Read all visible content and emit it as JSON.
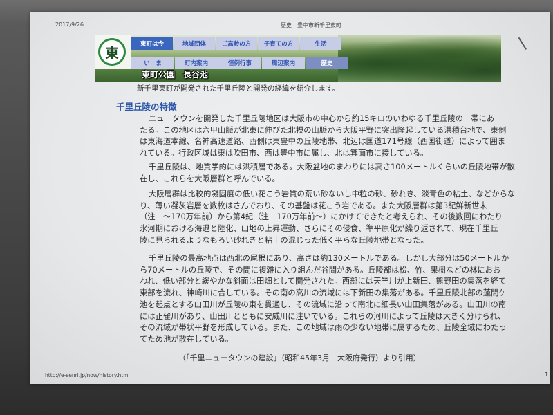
{
  "print_header": {
    "date": "2017/9/26",
    "title": "歴史　豊中市新千里東町"
  },
  "banner": {
    "logo_char": "東",
    "nav_primary": [
      {
        "label": "東町は今",
        "active": true
      },
      {
        "label": "地域団体",
        "active": false
      },
      {
        "label": "ご高齢の方",
        "active": false
      },
      {
        "label": "子育ての方",
        "active": false
      },
      {
        "label": "生活",
        "active": false
      }
    ],
    "nav_secondary": [
      {
        "label": "い　ま",
        "active": false
      },
      {
        "label": "町内案内",
        "active": false
      },
      {
        "label": "恒例行事",
        "active": false
      },
      {
        "label": "周辺案内",
        "active": false
      },
      {
        "label": "歴史",
        "active": true
      }
    ],
    "caption": "東町公園　長谷池"
  },
  "intro": "新千里東町が開発された千里丘陵と開発の経緯を紹介します。",
  "section": {
    "heading": "千里丘陵の特徴",
    "paragraphs": [
      {
        "lines": [
          "ニュータウンを開発した千里丘陵地区は大阪市の中心から約15キロのいわゆる千里丘陵の一帯にあ",
          "たる。この地区は六甲山脈が北東に伸びた北摂の山脈から大阪平野に突出隆起している洪積台地で、東側",
          "は東海道本線、名神高速道路、西側は東豊中の丘陵地帯、北辺は国道171号線（西国街道）によって囲ま",
          "れている。行政区域は東は吹田市、西は豊中市に属し、北は箕面市に接している。"
        ]
      },
      {
        "lines": [
          "千里丘陵は、地質学的には洪積層である。大阪盆地のまわりには高さ100メートルくらいの丘陵地帯が散",
          "在し、これらを大阪層群と呼んでいる。"
        ]
      },
      {
        "lines": [
          "大阪層群は比較的凝固度の低い花こう岩質の荒い砂ないし中粒の砂、砂れき、淡青色の粘土、などからな",
          "り、薄い凝灰岩層を数枚はさんでおり、その基盤は花こう岩である。また大阪層群は第3紀鮮新世末",
          "（注　～170万年前）から第4紀（注　170万年前～）にかけてできたと考えられ、その後数回にわたり",
          "氷河期における海退と陸化、山地の上昇運動、さらにその侵食、準平原化が繰り返されて、現在千里丘",
          "陵に見られるようなもろい砂れきと粘土の混じった低く平らな丘陵地帯となった。"
        ]
      },
      {
        "lines": [
          "千里丘陵の最高地点は西北の尾根にあり、高さは約130メートルである。しかし大部分は50メートルか",
          "ら70メートルの丘陵で、その間に複雑に入り組んだ谷間がある。丘陵部は松、竹、果樹などの林におお",
          "われ、低い部分と緩やかな斜面は田畑として開発された。西部には天竺川が上新田、熊野田の集落を経て",
          "東部を流れ、神崎川に合している。その南の高川の流域には下新田の集落がある。千里丘陵北部の蓮間ケ",
          "池を起点とする山田川が丘陵の東を貫通し、その流域に沿って南北に細長い山田集落がある。山田川の南",
          "には正雀川があり、山田川とともに安威川に注いでいる。これらの河川によって丘陵は大きく分けられ、",
          "その流域が帯状平野を形成している。また、この地域は雨の少ない地帯に属するため、丘陵全域にわたっ",
          "てため池が散在している。"
        ]
      }
    ]
  },
  "citation": "（「千里ニュータウンの建設」（昭和45年3月　大阪府発行）より引用）",
  "footer": {
    "url": "http://e-senri.jp/now/history.html",
    "page": "1"
  },
  "colors": {
    "heading": "#2a55a8",
    "tab": "#c7cde6",
    "tab_text": "#2f55b0",
    "tab_active": "#3a66c0",
    "tab_active_secondary": "#7d8fc2",
    "logo_green": "#2d8a3c"
  }
}
